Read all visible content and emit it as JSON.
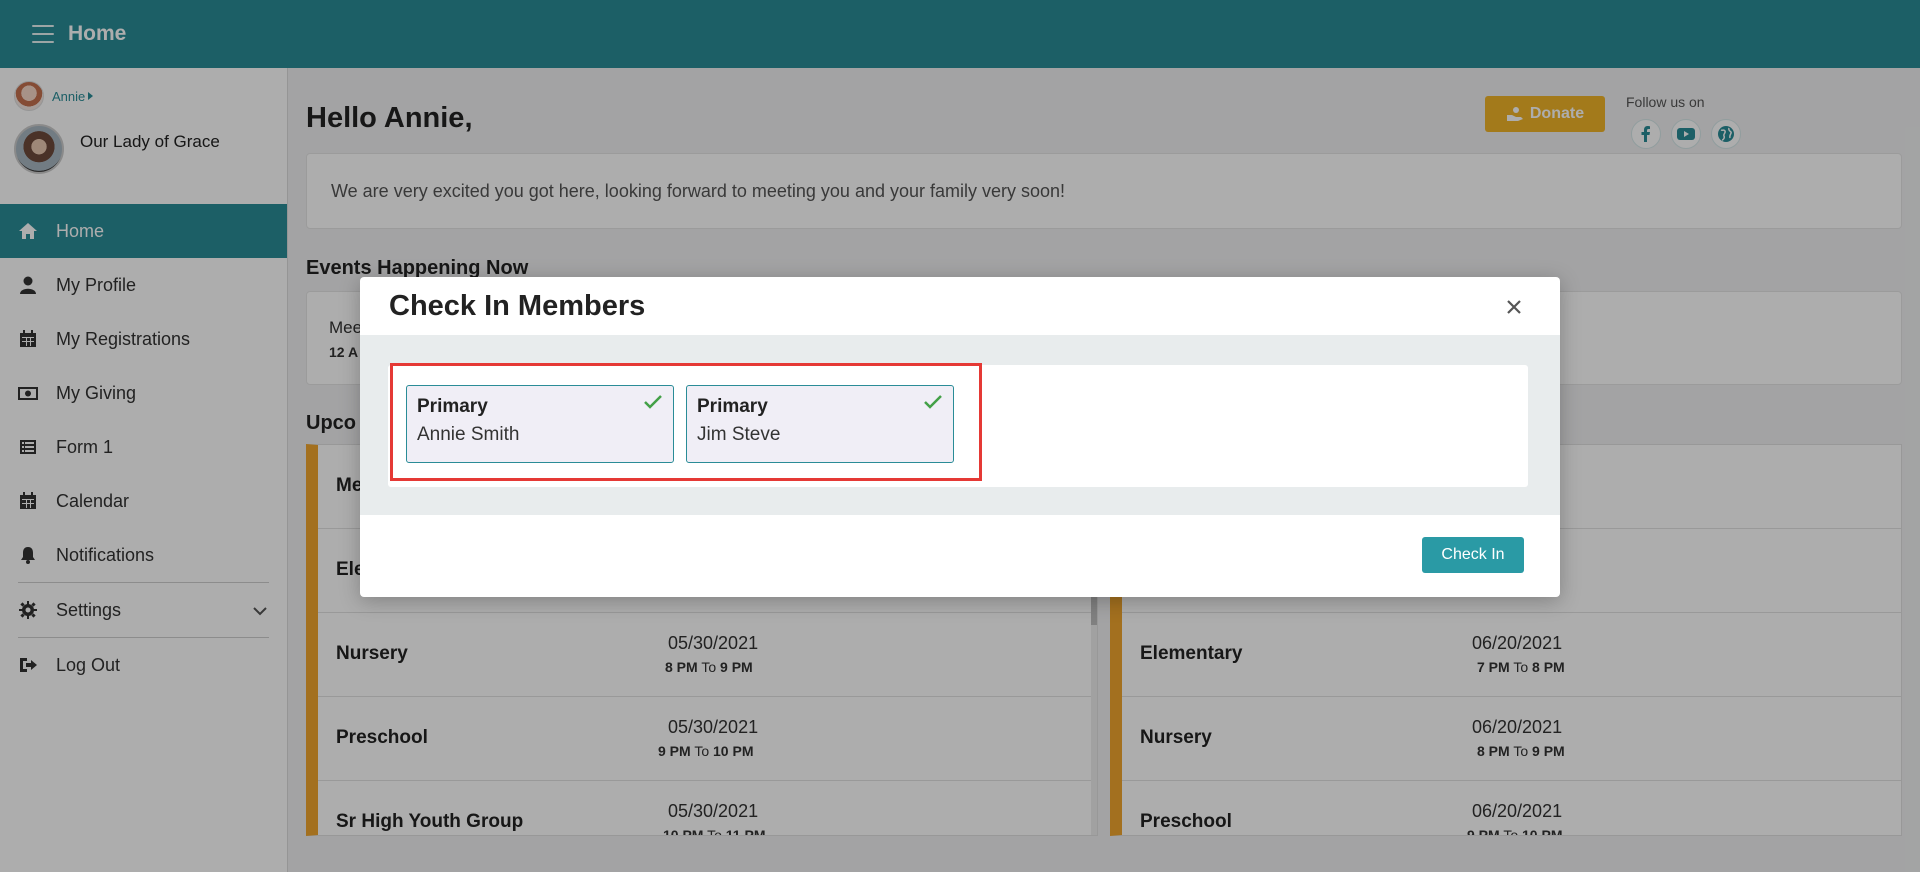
{
  "topbar": {
    "title": "Home"
  },
  "user": {
    "name": "Annie"
  },
  "parish": {
    "name": "Our Lady of Grace"
  },
  "nav": {
    "items": [
      {
        "label": "Home"
      },
      {
        "label": "My Profile"
      },
      {
        "label": "My Registrations"
      },
      {
        "label": "My Giving"
      },
      {
        "label": "Form 1"
      },
      {
        "label": "Calendar"
      },
      {
        "label": "Notifications"
      },
      {
        "label": "Settings"
      },
      {
        "label": "Log Out"
      }
    ]
  },
  "main": {
    "greeting": "Hello Annie,",
    "donate_label": "Donate",
    "follow_label": "Follow us on",
    "welcome_message": "We are very excited you got here, looking forward to meeting you and your family very soon!",
    "events_now_title": "Events Happening Now",
    "now_event": {
      "name": "Mee",
      "time": "12 A"
    },
    "upcoming_title": "Upco",
    "left_events": [
      {
        "name": "Me",
        "date": "",
        "start": "",
        "end": ""
      },
      {
        "name": "Ele",
        "date": "",
        "start": "",
        "end": ""
      },
      {
        "name": "Nursery",
        "date": "05/30/2021",
        "start": "8 PM",
        "end": "9 PM"
      },
      {
        "name": "Preschool",
        "date": "05/30/2021",
        "start": "9 PM",
        "end": "10 PM"
      },
      {
        "name": "Sr High Youth Group",
        "date": "05/30/2021",
        "start": "10 PM",
        "end": "11 PM"
      }
    ],
    "right_events": [
      {
        "name": "",
        "date": "1",
        "start": "",
        "end": "M"
      },
      {
        "name": "",
        "date": "1",
        "start": "",
        "end": "PM"
      },
      {
        "name": "Elementary",
        "date": "06/20/2021",
        "start": "7 PM",
        "end": "8 PM"
      },
      {
        "name": "Nursery",
        "date": "06/20/2021",
        "start": "8 PM",
        "end": "9 PM"
      },
      {
        "name": "Preschool",
        "date": "06/20/2021",
        "start": "9 PM",
        "end": "10 PM"
      }
    ],
    "to_word": "To"
  },
  "modal": {
    "title": "Check In Members",
    "members": [
      {
        "type": "Primary",
        "name": "Annie Smith",
        "checked": true
      },
      {
        "type": "Primary",
        "name": "Jim Steve",
        "checked": true
      }
    ],
    "checkin_label": "Check In"
  },
  "colors": {
    "teal": "#2a8c97",
    "accent_orange": "#f0a62e",
    "donate": "#f0b429",
    "highlight_red": "#e53935",
    "check_green": "#43a047"
  }
}
